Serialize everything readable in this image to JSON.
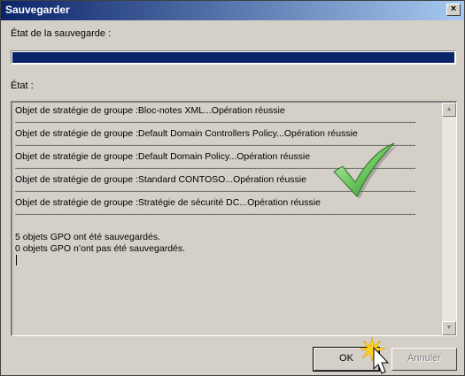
{
  "window": {
    "title": "Sauvegarder",
    "close_glyph": "×"
  },
  "status_label": "État de la sauvegarde :",
  "progress": {
    "value_percent": 100,
    "color": "#0a246a"
  },
  "state_label": "État :",
  "log": {
    "lines": [
      "Objet de stratégie de groupe :Bloc-notes XML...Opération réussie",
      "Objet de stratégie de groupe :Default Domain Controllers Policy...Opération réussie",
      "Objet de stratégie de groupe :Default Domain Policy...Opération réussie",
      "Objet de stratégie de groupe :Standard CONTOSO...Opération réussie",
      "Objet de stratégie de groupe :Stratégie de sécurité DC...Opération réussie"
    ],
    "separator": "-------------------------------------------------------------------------------------------------------------------------------------------------------------------------------------",
    "summary": [
      "5 objets GPO ont été sauvegardés.",
      "0 objets GPO n’ont pas été sauvegardés."
    ]
  },
  "buttons": {
    "ok": "OK",
    "cancel": "Annuler"
  },
  "icons": {
    "success": "green-checkmark-icon",
    "cursor": "mouse-pointer-icon"
  },
  "colors": {
    "title_bar_start": "#0a246a",
    "title_bar_end": "#a6caf0",
    "checkmark": "#4caf50",
    "dialog_bg": "#d4d0c8"
  }
}
